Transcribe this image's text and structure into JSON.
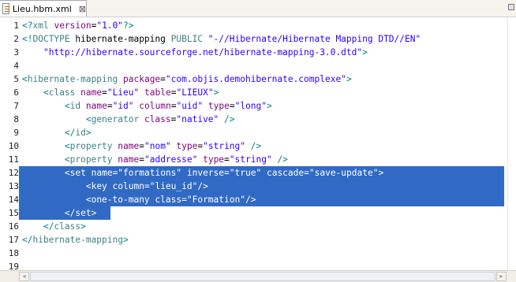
{
  "tab": {
    "title": "Lieu.hbm.xml",
    "close_glyph": "⊠"
  },
  "lines": [
    {
      "n": "1",
      "selected": false,
      "tokens": [
        [
          "pun",
          "<?"
        ],
        [
          "tag",
          "xml"
        ],
        [
          "txt",
          " "
        ],
        [
          "attr",
          "version"
        ],
        [
          "txt",
          "="
        ],
        [
          "val",
          "\"1.0\""
        ],
        [
          "pun",
          "?>"
        ]
      ]
    },
    {
      "n": "2",
      "selected": false,
      "tokens": [
        [
          "pun",
          "<!"
        ],
        [
          "tag",
          "DOCTYPE"
        ],
        [
          "txt",
          " hibernate-mapping "
        ],
        [
          "tag",
          "PUBLIC"
        ],
        [
          "txt",
          " "
        ],
        [
          "dtd",
          "\"-//Hibernate/Hibernate Mapping DTD//EN\""
        ]
      ]
    },
    {
      "n": "3",
      "selected": false,
      "tokens": [
        [
          "txt",
          "    "
        ],
        [
          "dtd",
          "\"http://hibernate.sourceforge.net/hibernate-mapping-3.0.dtd\""
        ],
        [
          "pun",
          ">"
        ]
      ]
    },
    {
      "n": "4",
      "selected": false,
      "tokens": []
    },
    {
      "n": "5",
      "selected": false,
      "tokens": [
        [
          "pun",
          "<"
        ],
        [
          "tag",
          "hibernate-mapping"
        ],
        [
          "txt",
          " "
        ],
        [
          "attr",
          "package"
        ],
        [
          "txt",
          "="
        ],
        [
          "val",
          "\"com.objis.demohibernate.complexe\""
        ],
        [
          "pun",
          ">"
        ]
      ]
    },
    {
      "n": "6",
      "selected": false,
      "tokens": [
        [
          "txt",
          "    "
        ],
        [
          "pun",
          "<"
        ],
        [
          "tag",
          "class"
        ],
        [
          "txt",
          " "
        ],
        [
          "attr",
          "name"
        ],
        [
          "txt",
          "="
        ],
        [
          "val",
          "\"Lieu\""
        ],
        [
          "txt",
          " "
        ],
        [
          "attr",
          "table"
        ],
        [
          "txt",
          "="
        ],
        [
          "val",
          "\"LIEUX\""
        ],
        [
          "pun",
          ">"
        ]
      ]
    },
    {
      "n": "7",
      "selected": false,
      "tokens": [
        [
          "txt",
          "        "
        ],
        [
          "pun",
          "<"
        ],
        [
          "tag",
          "id"
        ],
        [
          "txt",
          " "
        ],
        [
          "attr",
          "name"
        ],
        [
          "txt",
          "="
        ],
        [
          "val",
          "\"id\""
        ],
        [
          "txt",
          " "
        ],
        [
          "attr",
          "column"
        ],
        [
          "txt",
          "="
        ],
        [
          "val",
          "\"uid\""
        ],
        [
          "txt",
          " "
        ],
        [
          "attr",
          "type"
        ],
        [
          "txt",
          "="
        ],
        [
          "val",
          "\"long\""
        ],
        [
          "pun",
          ">"
        ]
      ]
    },
    {
      "n": "8",
      "selected": false,
      "tokens": [
        [
          "txt",
          "            "
        ],
        [
          "pun",
          "<"
        ],
        [
          "tag",
          "generator"
        ],
        [
          "txt",
          " "
        ],
        [
          "attr",
          "class"
        ],
        [
          "txt",
          "="
        ],
        [
          "val",
          "\"native\""
        ],
        [
          "txt",
          " "
        ],
        [
          "pun",
          "/>"
        ]
      ]
    },
    {
      "n": "9",
      "selected": false,
      "tokens": [
        [
          "txt",
          "        "
        ],
        [
          "pun",
          "</"
        ],
        [
          "tag",
          "id"
        ],
        [
          "pun",
          ">"
        ]
      ]
    },
    {
      "n": "10",
      "selected": false,
      "tokens": [
        [
          "txt",
          "        "
        ],
        [
          "pun",
          "<"
        ],
        [
          "tag",
          "property"
        ],
        [
          "txt",
          " "
        ],
        [
          "attr",
          "name"
        ],
        [
          "txt",
          "="
        ],
        [
          "val",
          "\"nom\""
        ],
        [
          "txt",
          " "
        ],
        [
          "attr",
          "type"
        ],
        [
          "txt",
          "="
        ],
        [
          "val",
          "\"string\""
        ],
        [
          "txt",
          " "
        ],
        [
          "pun",
          "/>"
        ]
      ]
    },
    {
      "n": "11",
      "selected": false,
      "tokens": [
        [
          "txt",
          "        "
        ],
        [
          "pun",
          "<"
        ],
        [
          "tag",
          "property"
        ],
        [
          "txt",
          " "
        ],
        [
          "attr",
          "name"
        ],
        [
          "txt",
          "="
        ],
        [
          "val",
          "\"addresse\""
        ],
        [
          "txt",
          " "
        ],
        [
          "attr",
          "type"
        ],
        [
          "txt",
          "="
        ],
        [
          "val",
          "\"string\""
        ],
        [
          "txt",
          " "
        ],
        [
          "pun",
          "/>"
        ]
      ]
    },
    {
      "n": "12",
      "selected": true,
      "tokens": [
        [
          "txt",
          "        "
        ],
        [
          "pun",
          "<"
        ],
        [
          "tag",
          "set"
        ],
        [
          "txt",
          " "
        ],
        [
          "attr",
          "name"
        ],
        [
          "txt",
          "="
        ],
        [
          "val",
          "\"formations\""
        ],
        [
          "txt",
          " "
        ],
        [
          "attr",
          "inverse"
        ],
        [
          "txt",
          "="
        ],
        [
          "val",
          "\"true\""
        ],
        [
          "txt",
          " "
        ],
        [
          "attr",
          "cascade"
        ],
        [
          "txt",
          "="
        ],
        [
          "val",
          "\"save-update\""
        ],
        [
          "pun",
          ">"
        ]
      ]
    },
    {
      "n": "13",
      "selected": true,
      "tokens": [
        [
          "txt",
          "            "
        ],
        [
          "pun",
          "<"
        ],
        [
          "tag",
          "key"
        ],
        [
          "txt",
          " "
        ],
        [
          "attr",
          "column"
        ],
        [
          "txt",
          "="
        ],
        [
          "val",
          "\"lieu_id\""
        ],
        [
          "pun",
          "/>"
        ]
      ]
    },
    {
      "n": "14",
      "selected": true,
      "tokens": [
        [
          "txt",
          "            "
        ],
        [
          "pun",
          "<"
        ],
        [
          "tag",
          "one-to-many"
        ],
        [
          "txt",
          " "
        ],
        [
          "attr",
          "class"
        ],
        [
          "txt",
          "="
        ],
        [
          "val",
          "\"Formation\""
        ],
        [
          "pun",
          "/>"
        ]
      ]
    },
    {
      "n": "15",
      "selected": true,
      "partial": true,
      "tokens": [
        [
          "txt",
          "        "
        ],
        [
          "pun",
          "</"
        ],
        [
          "tag",
          "set"
        ],
        [
          "pun",
          ">"
        ]
      ]
    },
    {
      "n": "16",
      "selected": false,
      "tokens": [
        [
          "txt",
          "    "
        ],
        [
          "pun",
          "</"
        ],
        [
          "tag",
          "class"
        ],
        [
          "pun",
          ">"
        ]
      ]
    },
    {
      "n": "17",
      "selected": false,
      "tokens": [
        [
          "pun",
          "</"
        ],
        [
          "tag",
          "hibernate-mapping"
        ],
        [
          "pun",
          ">"
        ]
      ]
    },
    {
      "n": "18",
      "selected": false,
      "tokens": []
    },
    {
      "n": "19",
      "selected": false,
      "tokens": []
    }
  ],
  "colors": {
    "tag": "#3f7f7f",
    "attr": "#7f007f",
    "val": "#2a00ff",
    "selection": "#316ac5"
  },
  "scrollbar": {
    "left_glyph": "◂",
    "right_glyph": "▸"
  }
}
